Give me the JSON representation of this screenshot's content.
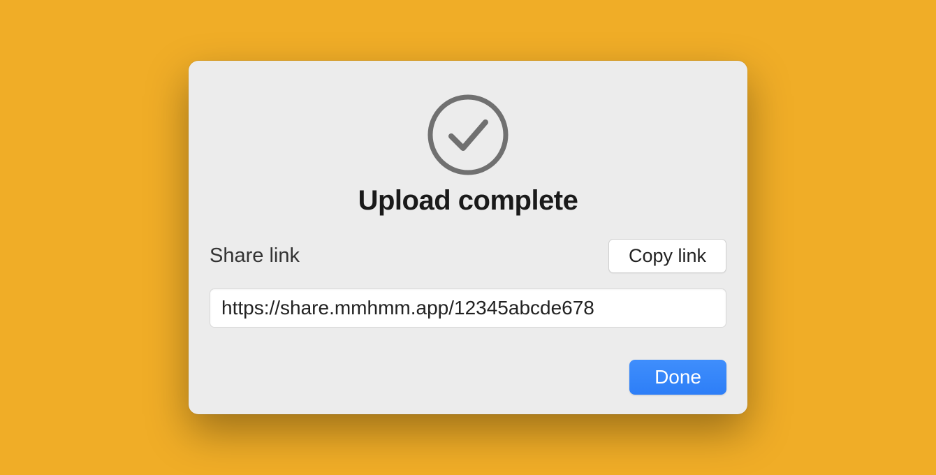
{
  "dialog": {
    "title": "Upload complete",
    "share_label": "Share link",
    "copy_button": "Copy link",
    "link_value": "https://share.mmhmm.app/12345abcde678",
    "done_button": "Done"
  },
  "colors": {
    "background": "#f0ad27",
    "dialog_bg": "#ececec",
    "primary_button": "#2d7ef7",
    "icon_stroke": "#707070"
  }
}
